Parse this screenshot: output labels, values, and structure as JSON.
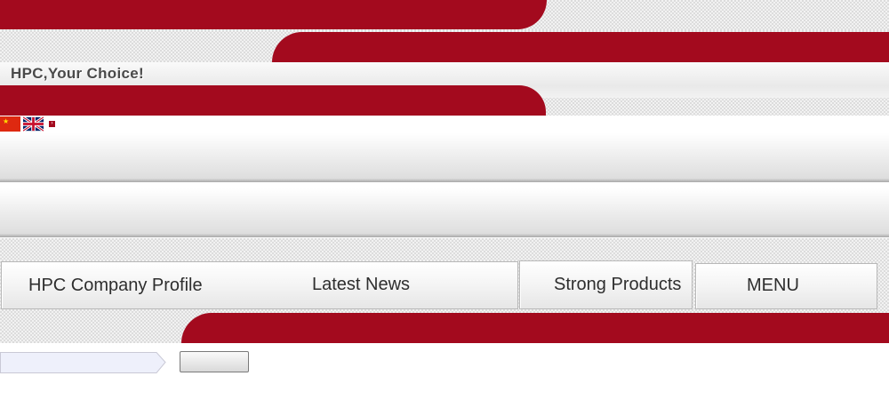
{
  "header": {
    "tagline": "HPC,Your Choice!"
  },
  "languages": [
    {
      "name": "Chinese",
      "icon": "cn-flag-icon"
    },
    {
      "name": "English",
      "icon": "uk-flag-icon"
    }
  ],
  "nav": {
    "items": [
      {
        "label": "HPC Company Profile"
      },
      {
        "label": "Latest News"
      },
      {
        "label": "Strong Products"
      },
      {
        "label": "MENU"
      }
    ]
  },
  "search": {
    "placeholder": "",
    "value": "",
    "button_label": ""
  },
  "colors": {
    "brand_red": "#a30a1e",
    "band_gray": "#eeeeee",
    "text": "#2e2e2e"
  }
}
